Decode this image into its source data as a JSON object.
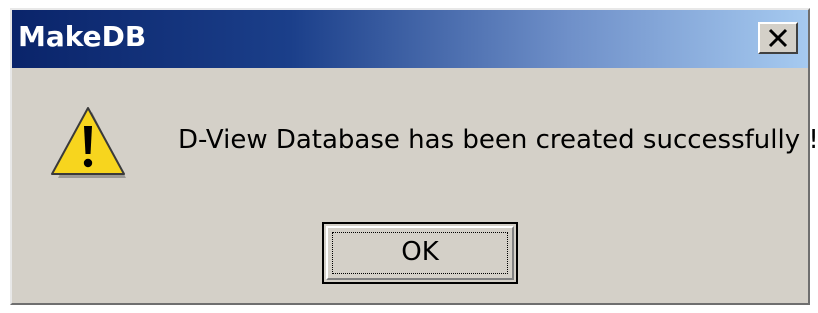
{
  "window": {
    "title": "MakeDB",
    "close_icon": "close-icon"
  },
  "dialog": {
    "icon": "warning-icon",
    "message": "D-View Database has been created successfully !",
    "ok_label": "OK"
  },
  "colors": {
    "dialog_bg": "#d4d0c8",
    "title_gradient_start": "#0a246a",
    "title_gradient_end": "#a6caf0",
    "warning_yellow": "#f7d51e"
  }
}
